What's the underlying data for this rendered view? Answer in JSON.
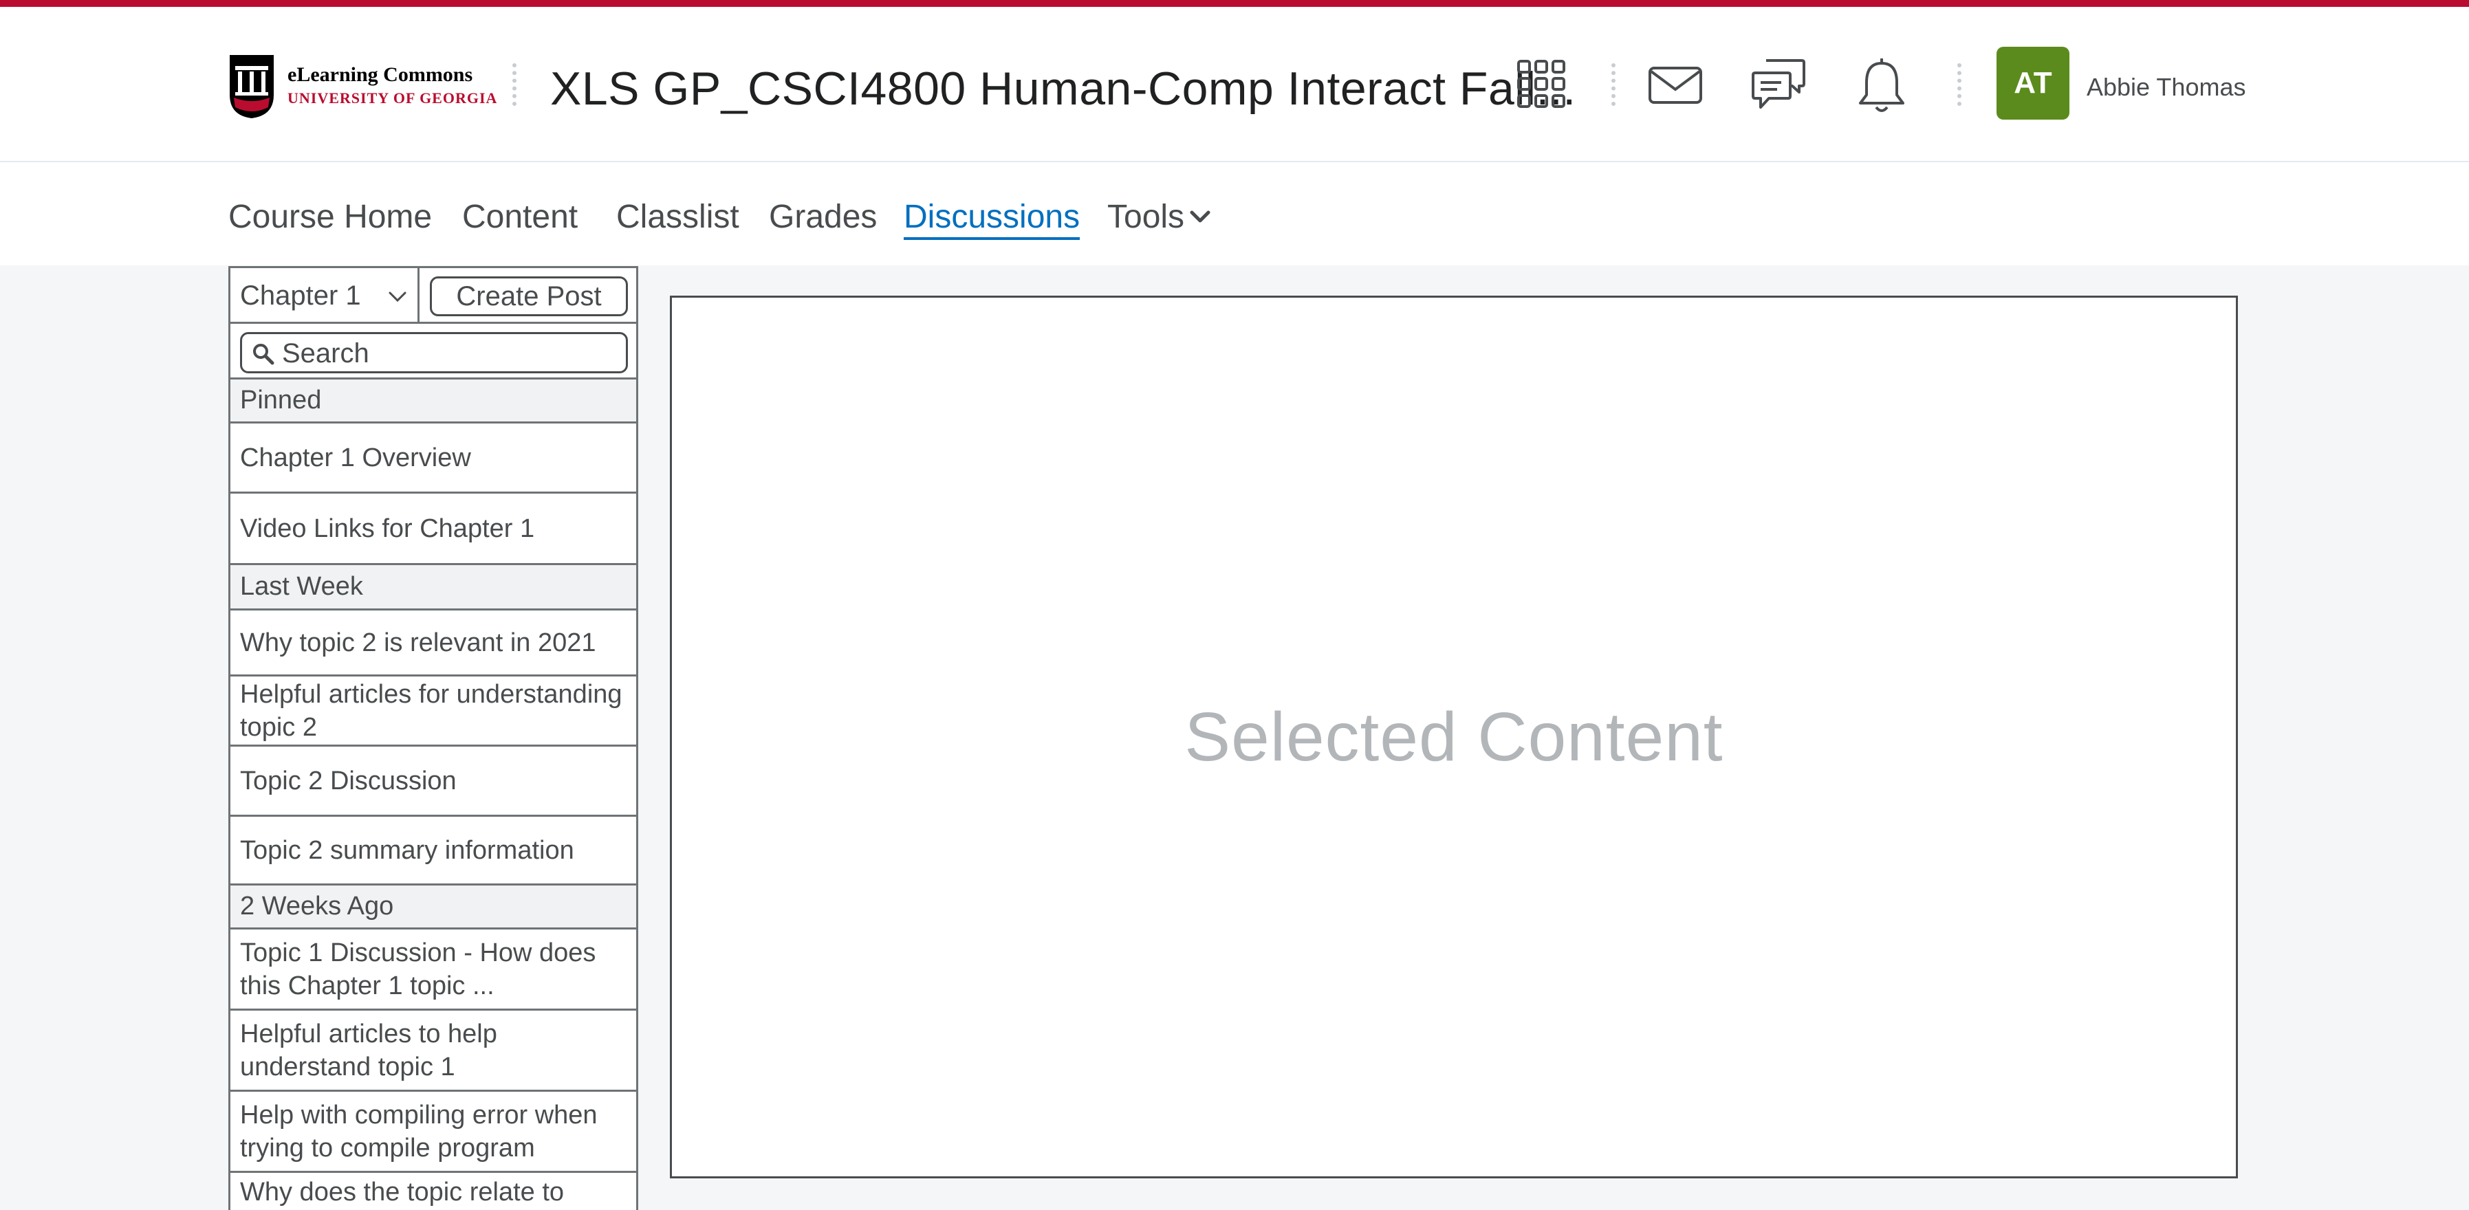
{
  "header": {
    "logo_line1": "eLearning Commons",
    "logo_line2": "UNIVERSITY OF GEORGIA",
    "course_title": "XLS GP_CSCI4800 Human-Comp Interact Fall...",
    "icons": [
      "apps-grid-icon",
      "mail-icon",
      "chat-icon",
      "bell-icon"
    ],
    "avatar_initials": "AT",
    "user_name": "Abbie Thomas"
  },
  "nav": {
    "items": [
      "Course Home",
      "Content",
      "Classlist",
      "Grades",
      "Discussions",
      "Tools"
    ],
    "active": "Discussions"
  },
  "sidebar": {
    "chapter_select": "Chapter 1",
    "create_post": "Create Post",
    "search_placeholder": "Search",
    "groups": [
      {
        "title": "Pinned",
        "items": [
          "Chapter 1 Overview",
          "Video Links for Chapter 1"
        ]
      },
      {
        "title": "Last Week",
        "items": [
          "Why topic 2 is relevant in 2021",
          "Helpful articles for understanding topic 2",
          "Topic 2 Discussion",
          "Topic 2 summary information"
        ]
      },
      {
        "title": "2 Weeks Ago",
        "items": [
          "Topic 1 Discussion - How does this Chapter 1 topic ...",
          "Helpful articles to help understand topic 1",
          "Help with compiling error when trying to compile program",
          "Why does the topic relate to"
        ]
      }
    ]
  },
  "content": {
    "placeholder": "Selected Content"
  },
  "colors": {
    "top_bar": "#ba0c2f",
    "active_link": "#006fbf",
    "avatar": "#5c8b1d"
  }
}
